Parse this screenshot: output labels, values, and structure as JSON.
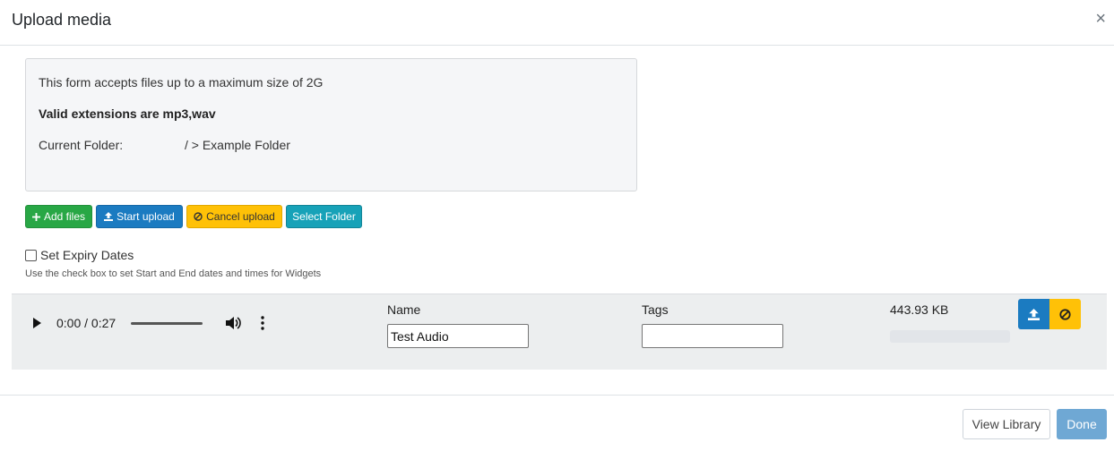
{
  "modal": {
    "title": "Upload media",
    "close_glyph": "×"
  },
  "info": {
    "max_size_text": "This form accepts files up to a maximum size of 2G",
    "valid_extensions_text": "Valid extensions are mp3,wav",
    "folder_label": "Current Folder:",
    "folder_value": "/ > Example Folder"
  },
  "toolbar": {
    "add_files": "Add files",
    "start_upload": "Start upload",
    "cancel_upload": "Cancel upload",
    "select_folder": "Select Folder"
  },
  "expiry": {
    "label": "Set Expiry Dates",
    "checked": false,
    "help": "Use the check box to set Start and End dates and times for Widgets"
  },
  "file": {
    "player_time": "0:00 / 0:27",
    "name_label": "Name",
    "name_value": "Test Audio",
    "tags_label": "Tags",
    "tags_value": "",
    "size": "443.93 KB",
    "upload_progress": 0
  },
  "footer": {
    "view_library": "View Library",
    "done": "Done"
  },
  "colors": {
    "success": "#28a745",
    "primary": "#1b7bc1",
    "warning": "#ffc107",
    "info": "#17a2b8",
    "done_disabled": "#6fa8d4"
  },
  "icons": {
    "add": "plus-icon",
    "start": "upload-icon",
    "cancel": "ban-icon",
    "play": "play-icon",
    "volume": "volume-icon",
    "more": "more-vertical-icon"
  }
}
